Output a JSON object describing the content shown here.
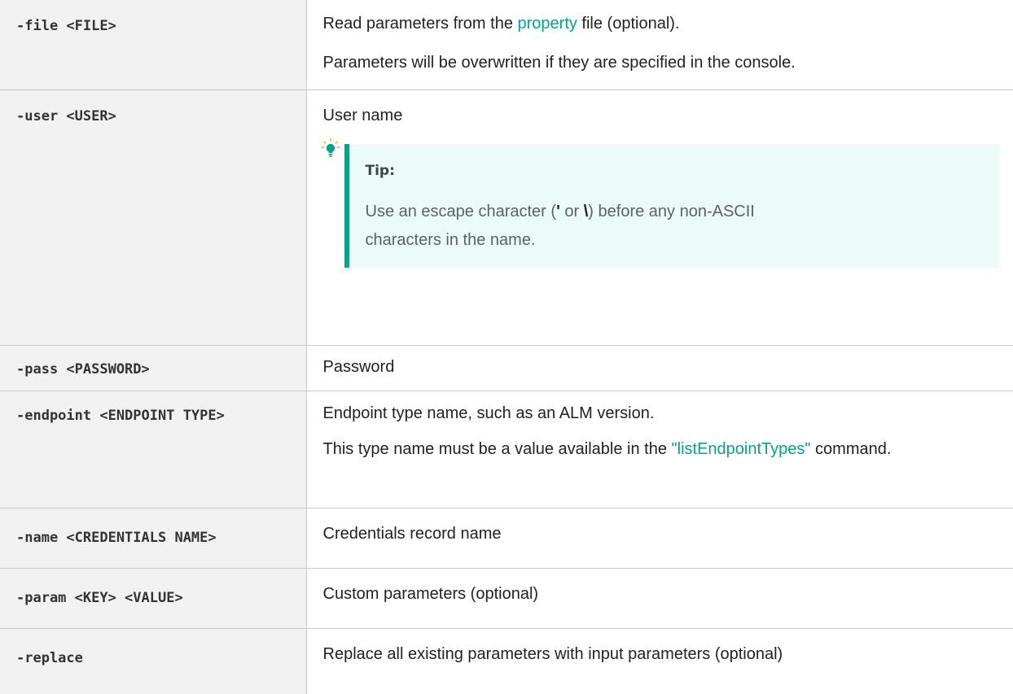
{
  "rows": [
    {
      "param": "-file <FILE>",
      "desc_pre": "Read parameters from the ",
      "desc_link": "property",
      "desc_post": " file (optional).",
      "desc2": "Parameters will be overwritten if they are specified in the console."
    },
    {
      "param": "-user <USER>",
      "desc": "User name",
      "tip": {
        "icon": "lightbulb-icon",
        "title": "Tip:",
        "text_a": "Use an escape character (",
        "char1": "'",
        "text_b": " or ",
        "char2": "\\",
        "text_c": ") before any non-ASCII characters in the name."
      }
    },
    {
      "param": "-pass <PASSWORD>",
      "desc": "Password"
    },
    {
      "param": "-endpoint <ENDPOINT TYPE>",
      "desc": "Endpoint type name, such as an ALM version.",
      "desc2_pre": "This type name must be a value available in the ",
      "desc2_link": "\"listEndpointTypes\"",
      "desc2_post": " command."
    },
    {
      "param": "-name <CREDENTIALS NAME>",
      "desc": "Credentials record name"
    },
    {
      "param": "-param <KEY> <VALUE>",
      "desc": "Custom parameters (optional)"
    },
    {
      "param": "-replace",
      "desc": "Replace all existing parameters with input parameters (optional)"
    }
  ],
  "colors": {
    "link": "#02a48a",
    "tip_bg": "#eafbf8",
    "tip_bar": "#02a48a",
    "name_cell_bg": "#f1f1f1",
    "border": "#c9c9c9"
  }
}
